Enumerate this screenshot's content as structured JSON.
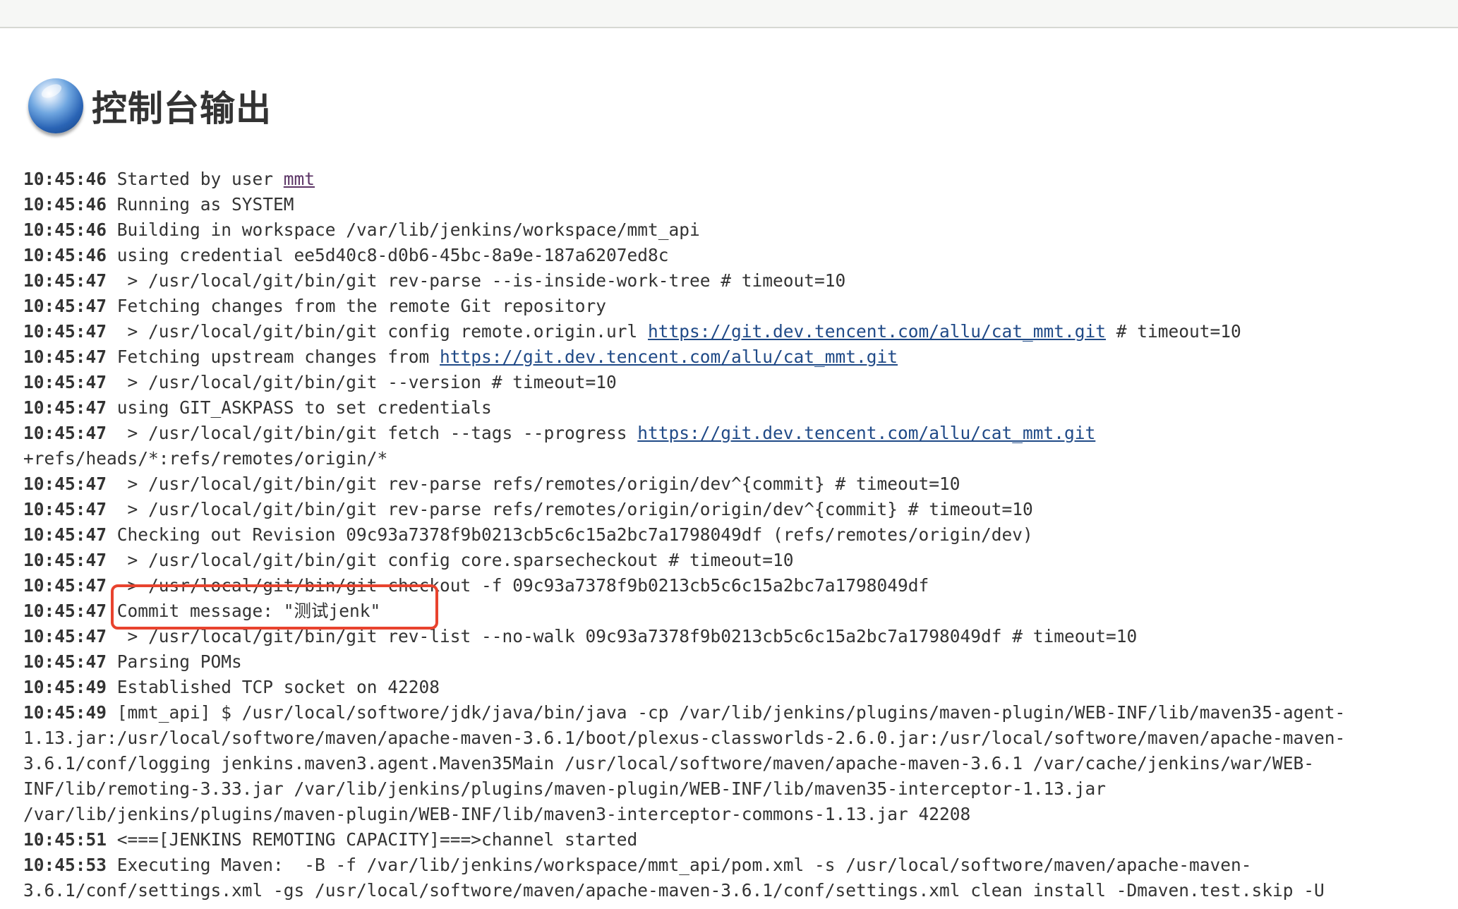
{
  "page": {
    "title": "控制台输出"
  },
  "console": {
    "lines": [
      {
        "ts": "10:45:46",
        "segments": [
          {
            "text": " Started by user "
          },
          {
            "text": "mmt",
            "user": true
          }
        ]
      },
      {
        "ts": "10:45:46",
        "segments": [
          {
            "text": " Running as SYSTEM"
          }
        ]
      },
      {
        "ts": "10:45:46",
        "segments": [
          {
            "text": " Building in workspace /var/lib/jenkins/workspace/mmt_api"
          }
        ]
      },
      {
        "ts": "10:45:46",
        "segments": [
          {
            "text": " using credential ee5d40c8-d0b6-45bc-8a9e-187a6207ed8c"
          }
        ]
      },
      {
        "ts": "10:45:47",
        "segments": [
          {
            "text": "  > /usr/local/git/bin/git rev-parse --is-inside-work-tree # timeout=10"
          }
        ]
      },
      {
        "ts": "10:45:47",
        "segments": [
          {
            "text": " Fetching changes from the remote Git repository"
          }
        ]
      },
      {
        "ts": "10:45:47",
        "segments": [
          {
            "text": "  > /usr/local/git/bin/git config remote.origin.url "
          },
          {
            "text": "https://git.dev.tencent.com/allu/cat_mmt.git",
            "link": true
          },
          {
            "text": " # timeout=10"
          }
        ]
      },
      {
        "ts": "10:45:47",
        "segments": [
          {
            "text": " Fetching upstream changes from "
          },
          {
            "text": "https://git.dev.tencent.com/allu/cat_mmt.git",
            "link": true
          }
        ]
      },
      {
        "ts": "10:45:47",
        "segments": [
          {
            "text": "  > /usr/local/git/bin/git --version # timeout=10"
          }
        ]
      },
      {
        "ts": "10:45:47",
        "segments": [
          {
            "text": " using GIT_ASKPASS to set credentials"
          }
        ]
      },
      {
        "ts": "10:45:47",
        "segments": [
          {
            "text": "  > /usr/local/git/bin/git fetch --tags --progress "
          },
          {
            "text": "https://git.dev.tencent.com/allu/cat_mmt.git",
            "link": true
          }
        ]
      },
      {
        "ts": "",
        "segments": [
          {
            "text": "+refs/heads/*:refs/remotes/origin/*"
          }
        ]
      },
      {
        "ts": "10:45:47",
        "segments": [
          {
            "text": "  > /usr/local/git/bin/git rev-parse refs/remotes/origin/dev^{commit} # timeout=10"
          }
        ]
      },
      {
        "ts": "10:45:47",
        "segments": [
          {
            "text": "  > /usr/local/git/bin/git rev-parse refs/remotes/origin/origin/dev^{commit} # timeout=10"
          }
        ]
      },
      {
        "ts": "10:45:47",
        "segments": [
          {
            "text": " Checking out Revision 09c93a7378f9b0213cb5c6c15a2bc7a1798049df (refs/remotes/origin/dev)"
          }
        ]
      },
      {
        "ts": "10:45:47",
        "segments": [
          {
            "text": "  > /usr/local/git/bin/git config core.sparsecheckout # timeout=10"
          }
        ]
      },
      {
        "ts": "10:45:47",
        "segments": [
          {
            "text": "  > /usr/local/git/bin/git checkout -f 09c93a7378f9b0213cb5c6c15a2bc7a1798049df"
          }
        ]
      },
      {
        "ts": "10:45:47",
        "segments": [
          {
            "text": " Commit message: \"测试jenk\""
          }
        ]
      },
      {
        "ts": "10:45:47",
        "segments": [
          {
            "text": "  > /usr/local/git/bin/git rev-list --no-walk 09c93a7378f9b0213cb5c6c15a2bc7a1798049df # timeout=10"
          }
        ]
      },
      {
        "ts": "10:45:47",
        "segments": [
          {
            "text": " Parsing POMs"
          }
        ]
      },
      {
        "ts": "10:45:49",
        "segments": [
          {
            "text": " Established TCP socket on 42208"
          }
        ]
      },
      {
        "ts": "10:45:49",
        "segments": [
          {
            "text": " [mmt_api] $ /usr/local/softwore/jdk/java/bin/java -cp /var/lib/jenkins/plugins/maven-plugin/WEB-INF/lib/maven35-agent-"
          }
        ]
      },
      {
        "ts": "",
        "segments": [
          {
            "text": "1.13.jar:/usr/local/softwore/maven/apache-maven-3.6.1/boot/plexus-classworlds-2.6.0.jar:/usr/local/softwore/maven/apache-maven-"
          }
        ]
      },
      {
        "ts": "",
        "segments": [
          {
            "text": "3.6.1/conf/logging jenkins.maven3.agent.Maven35Main /usr/local/softwore/maven/apache-maven-3.6.1 /var/cache/jenkins/war/WEB-"
          }
        ]
      },
      {
        "ts": "",
        "segments": [
          {
            "text": "INF/lib/remoting-3.33.jar /var/lib/jenkins/plugins/maven-plugin/WEB-INF/lib/maven35-interceptor-1.13.jar"
          }
        ]
      },
      {
        "ts": "",
        "segments": [
          {
            "text": "/var/lib/jenkins/plugins/maven-plugin/WEB-INF/lib/maven3-interceptor-commons-1.13.jar 42208"
          }
        ]
      },
      {
        "ts": "10:45:51",
        "segments": [
          {
            "text": " <===[JENKINS REMOTING CAPACITY]===>channel started"
          }
        ]
      },
      {
        "ts": "10:45:53",
        "segments": [
          {
            "text": " Executing Maven:  -B -f /var/lib/jenkins/workspace/mmt_api/pom.xml -s /usr/local/softwore/maven/apache-maven-"
          }
        ]
      },
      {
        "ts": "",
        "segments": [
          {
            "text": "3.6.1/conf/settings.xml -gs /usr/local/softwore/maven/apache-maven-3.6.1/conf/settings.xml clean install -Dmaven.test.skip -U"
          }
        ]
      }
    ]
  },
  "colors": {
    "link": "#204a87",
    "user_link": "#5c3566",
    "highlight": "#e8432e",
    "text": "#333333"
  },
  "icons": {
    "title_icon": "globe-icon"
  }
}
